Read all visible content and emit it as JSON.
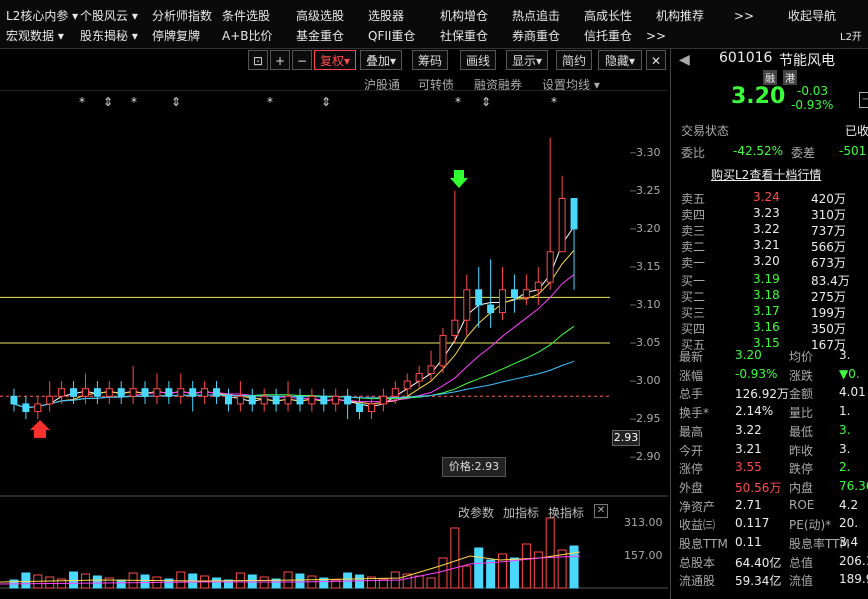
{
  "top_menu": {
    "row1": [
      "L2核心内参",
      "个股风云",
      "分析师指数",
      "条件选股",
      "高级选股",
      "选股器",
      "机构增仓",
      "热点追击",
      "高成长性",
      "机构推荐",
      ">>",
      "收起导航"
    ],
    "row2": [
      "宏观数据",
      "股东揭秘",
      "停牌复牌",
      "A+B比价",
      "基金重仓",
      "QFII重仓",
      "社保重仓",
      "券商重仓",
      "信托重仓",
      ">>",
      "L2开"
    ]
  },
  "toolbar": {
    "buttons": [
      "复权",
      "叠加",
      "筹码",
      "画线",
      "显示",
      "简约",
      "隐藏"
    ],
    "sub": [
      "沪股通",
      "可转债",
      "融资融券",
      "设置均线"
    ]
  },
  "chart_data": {
    "type": "candlestick",
    "ylim": [
      2.87,
      3.33
    ],
    "yticks": [
      "3.30",
      "3.25",
      "3.20",
      "3.15",
      "3.10",
      "3.05",
      "3.00",
      "2.95",
      "2.90"
    ],
    "current_price_label": "2.93",
    "tooltip": "价格:2.93",
    "candles": [
      [
        2.98,
        2.97,
        2.99,
        2.96
      ],
      [
        2.97,
        2.96,
        2.98,
        2.95
      ],
      [
        2.96,
        2.97,
        2.98,
        2.95
      ],
      [
        2.97,
        2.98,
        3.0,
        2.96
      ],
      [
        2.98,
        2.99,
        3.0,
        2.97
      ],
      [
        2.99,
        2.98,
        3.0,
        2.97
      ],
      [
        2.98,
        2.99,
        3.01,
        2.97
      ],
      [
        2.99,
        2.98,
        3.0,
        2.97
      ],
      [
        2.98,
        2.99,
        3.0,
        2.97
      ],
      [
        2.99,
        2.98,
        3.0,
        2.97
      ],
      [
        2.98,
        2.99,
        3.02,
        2.97
      ],
      [
        2.99,
        2.98,
        3.0,
        2.97
      ],
      [
        2.98,
        2.99,
        3.01,
        2.97
      ],
      [
        2.99,
        2.98,
        3.0,
        2.97
      ],
      [
        2.98,
        2.99,
        3.01,
        2.97
      ],
      [
        2.99,
        2.98,
        3.0,
        2.96
      ],
      [
        2.98,
        2.99,
        3.0,
        2.97
      ],
      [
        2.99,
        2.98,
        3.0,
        2.97
      ],
      [
        2.98,
        2.97,
        2.99,
        2.96
      ],
      [
        2.97,
        2.98,
        3.0,
        2.96
      ],
      [
        2.98,
        2.97,
        2.99,
        2.96
      ],
      [
        2.97,
        2.98,
        2.99,
        2.96
      ],
      [
        2.98,
        2.97,
        2.99,
        2.96
      ],
      [
        2.97,
        2.98,
        3.0,
        2.96
      ],
      [
        2.98,
        2.97,
        2.99,
        2.96
      ],
      [
        2.97,
        2.98,
        2.99,
        2.96
      ],
      [
        2.98,
        2.97,
        2.99,
        2.96
      ],
      [
        2.97,
        2.98,
        2.99,
        2.96
      ],
      [
        2.98,
        2.97,
        2.99,
        2.95
      ],
      [
        2.97,
        2.96,
        2.98,
        2.95
      ],
      [
        2.96,
        2.97,
        2.98,
        2.95
      ],
      [
        2.97,
        2.98,
        2.99,
        2.96
      ],
      [
        2.98,
        2.99,
        3.0,
        2.97
      ],
      [
        2.99,
        3.0,
        3.01,
        2.98
      ],
      [
        3.0,
        3.01,
        3.02,
        2.99
      ],
      [
        3.01,
        3.02,
        3.04,
        3.0
      ],
      [
        3.02,
        3.06,
        3.07,
        3.01
      ],
      [
        3.06,
        3.08,
        3.25,
        3.05
      ],
      [
        3.08,
        3.12,
        3.14,
        3.06
      ],
      [
        3.12,
        3.1,
        3.15,
        3.07
      ],
      [
        3.1,
        3.09,
        3.16,
        3.07
      ],
      [
        3.09,
        3.12,
        3.15,
        3.08
      ],
      [
        3.12,
        3.11,
        3.14,
        3.09
      ],
      [
        3.11,
        3.12,
        3.14,
        3.1
      ],
      [
        3.12,
        3.13,
        3.15,
        3.1
      ],
      [
        3.13,
        3.17,
        3.32,
        3.12
      ],
      [
        3.17,
        3.24,
        3.27,
        3.2
      ],
      [
        3.24,
        3.2,
        3.22,
        3.12
      ]
    ],
    "volume_ticks": [
      "313.00",
      "157.00"
    ]
  },
  "volume_toolbar": [
    "改参数",
    "加指标",
    "换指标"
  ],
  "stock": {
    "code": "601016",
    "name": "节能风电",
    "tags": [
      "融",
      "港"
    ],
    "price": "3.20",
    "change": "-0.03",
    "change_pct": "-0.93%",
    "status_label": "交易状态",
    "status_value": "已收",
    "weibi_label": "委比",
    "weibi_value": "-42.52%",
    "weicha_label": "委差",
    "weicha_value": "-501",
    "l2_link": "购买L2查看十档行情"
  },
  "order_book": {
    "asks": [
      {
        "label": "卖五",
        "price": "3.24",
        "vol": "420万"
      },
      {
        "label": "卖四",
        "price": "3.23",
        "vol": "310万"
      },
      {
        "label": "卖三",
        "price": "3.22",
        "vol": "737万"
      },
      {
        "label": "卖二",
        "price": "3.21",
        "vol": "566万"
      },
      {
        "label": "卖一",
        "price": "3.20",
        "vol": "673万"
      }
    ],
    "bids": [
      {
        "label": "买一",
        "price": "3.19",
        "vol": "83.4万"
      },
      {
        "label": "买二",
        "price": "3.18",
        "vol": "275万"
      },
      {
        "label": "买三",
        "price": "3.17",
        "vol": "199万"
      },
      {
        "label": "买四",
        "price": "3.16",
        "vol": "350万"
      },
      {
        "label": "买五",
        "price": "3.15",
        "vol": "167万"
      }
    ]
  },
  "stats": [
    {
      "l1": "最新",
      "v1": "3.20",
      "l2": "均价",
      "v2": "3."
    },
    {
      "l1": "涨幅",
      "v1": "-0.93%",
      "l2": "涨跌",
      "v2": "▼0."
    },
    {
      "l1": "总手",
      "v1": "126.92万",
      "l2": "金额",
      "v2": "4.01"
    },
    {
      "l1": "换手*",
      "v1": "2.14%",
      "l2": "量比",
      "v2": "1."
    },
    {
      "l1": "最高",
      "v1": "3.22",
      "l2": "最低",
      "v2": "3."
    },
    {
      "l1": "今开",
      "v1": "3.21",
      "l2": "昨收",
      "v2": "3."
    },
    {
      "l1": "涨停",
      "v1": "3.55",
      "l2": "跌停",
      "v2": "2."
    },
    {
      "l1": "外盘",
      "v1": "50.56万",
      "l2": "内盘",
      "v2": "76.36"
    },
    {
      "l1": "净资产",
      "v1": "2.71",
      "l2": "ROE",
      "v2": "4.2"
    },
    {
      "l1": "收益㈢",
      "v1": "0.117",
      "l2": "PE(动)*",
      "v2": "20."
    },
    {
      "l1": "股息TTM",
      "v1": "0.11",
      "l2": "股息率TTM",
      "v2": "3.4"
    },
    {
      "l1": "总股本",
      "v1": "64.40亿",
      "l2": "总值",
      "v2": "206.1"
    },
    {
      "l1": "流通股",
      "v1": "59.34亿",
      "l2": "流值",
      "v2": "189.9"
    }
  ],
  "colors": {
    "up": "#ff4a4a",
    "down": "#3cff3c",
    "bg": "#000000"
  }
}
